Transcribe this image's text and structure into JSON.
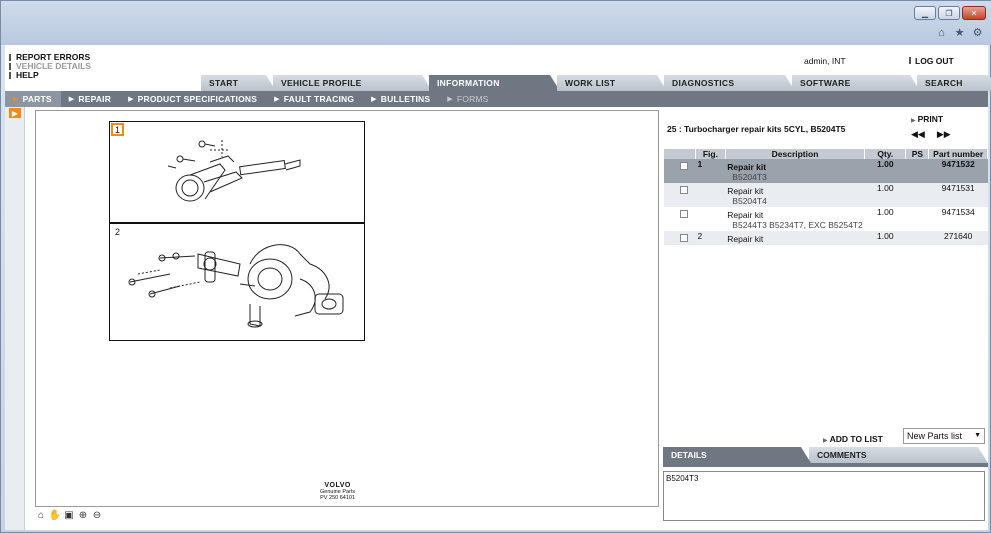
{
  "window": {
    "buttons": [
      "▁",
      "❐",
      "✕"
    ],
    "tools": [
      "home-icon",
      "star-icon",
      "gear-icon"
    ]
  },
  "toplinks": {
    "report_errors": "REPORT ERRORS",
    "vehicle_details": "VEHICLE DETAILS",
    "help": "HELP"
  },
  "user": {
    "info": "admin, INT",
    "logout": "LOG OUT"
  },
  "main_tabs": [
    {
      "label": "START"
    },
    {
      "label": "VEHICLE PROFILE"
    },
    {
      "label": "INFORMATION"
    },
    {
      "label": "WORK LIST"
    },
    {
      "label": "DIAGNOSTICS"
    },
    {
      "label": "SOFTWARE"
    },
    {
      "label": "SEARCH"
    }
  ],
  "sub_nav": [
    {
      "label": "PARTS"
    },
    {
      "label": "REPAIR"
    },
    {
      "label": "PRODUCT SPECIFICATIONS"
    },
    {
      "label": "FAULT TRACING"
    },
    {
      "label": "BULLETINS"
    },
    {
      "label": "FORMS"
    }
  ],
  "image_pane": {
    "fig1": "1",
    "fig2": "2",
    "volvo_logo": "VOLVO",
    "volvo_line1": "Genuine Parts",
    "volvo_line2": "PV 250 64101",
    "tools": [
      "home-icon",
      "hand-icon",
      "fit-icon",
      "zoom-in-icon",
      "zoom-out-icon"
    ]
  },
  "parts_panel": {
    "title": "25 : Turbocharger repair kits 5CYL, B5204T5",
    "print": "PRINT",
    "nav_prev": "◀◀",
    "nav_next": "▶▶",
    "headers": {
      "fig": "Fig.",
      "description": "Description",
      "qty": "Qty.",
      "ps": "PS",
      "part_number": "Part number"
    },
    "rows": [
      {
        "fig": "1",
        "description": "Repair kit",
        "sub": "B5204T3",
        "qty": "1.00",
        "ps": "",
        "part_number": "9471532"
      },
      {
        "fig": "",
        "description": "Repair kit",
        "sub": "B5204T4",
        "qty": "1.00",
        "ps": "",
        "part_number": "9471531"
      },
      {
        "fig": "",
        "description": "Repair kit",
        "sub": "B5244T3 B5234T7, EXC B5254T2",
        "qty": "1.00",
        "ps": "",
        "part_number": "9471534"
      },
      {
        "fig": "2",
        "description": "Repair kit",
        "sub": "",
        "qty": "1.00",
        "ps": "",
        "part_number": "271640"
      }
    ],
    "add_to_list": "ADD TO LIST",
    "list_select": "New Parts list",
    "tabs": {
      "details": "DETAILS",
      "comments": "COMMENTS"
    },
    "details_text": "B5204T3"
  },
  "colors": {
    "accent": "#f08a1c",
    "nav_bg": "#6f7882",
    "selected_row": "#9aa2ac"
  }
}
